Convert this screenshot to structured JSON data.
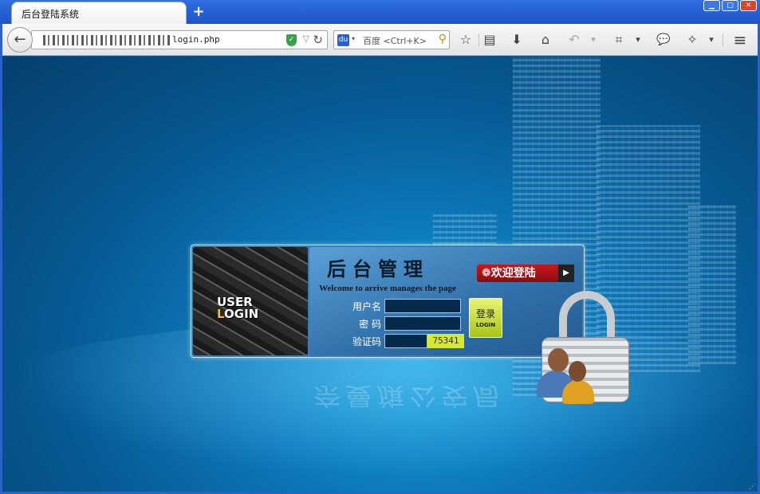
{
  "browser": {
    "tab_title": "后台登陆系统",
    "new_tab_label": "+",
    "window_controls": {
      "minimize": "▁",
      "maximize": "▢",
      "close": "✕"
    },
    "url": "login.php",
    "search_placeholder": "百度 <Ctrl+K>",
    "search_engine_label": "du",
    "icons": [
      "back-icon",
      "shield-icon",
      "dropdown-icon",
      "reload-icon",
      "search-icon",
      "bookmark-star-icon",
      "reading-list-icon",
      "download-icon",
      "home-icon",
      "undo-icon",
      "crop-icon",
      "chat-icon",
      "addon-icon",
      "menu-icon"
    ],
    "toolbar_glyphs": {
      "back": "←",
      "star": "☆",
      "list": "▤",
      "download": "⬇",
      "home": "⌂",
      "undo": "↶",
      "caret": "▾",
      "crop": "⌗",
      "chat": "💬",
      "addon": "✧",
      "menu": "≡",
      "reload": "↻",
      "search_go": "⚲"
    }
  },
  "login": {
    "logo_line1": "USER",
    "logo_line2_first": "L",
    "logo_line2_rest": "OGIN",
    "heading": "后台管理",
    "subheading": "Welcome to arrive manages the page",
    "welcome_badge": "❁欢迎登陆",
    "welcome_arrow": "▶",
    "username_label": "用户名",
    "password_label": "密  码",
    "captcha_label": "验证码",
    "username_value": "",
    "password_value": "",
    "captcha_value": "",
    "captcha_code": "75341",
    "login_button_cn": "登录",
    "login_button_en": "LOGIN"
  },
  "watermark": "奈曼旗公安局",
  "colors": {
    "accent": "#0d7bbc",
    "title_bar": "#2f6fe0",
    "welcome_badge": "#c9181b",
    "login_button": "#a9c516"
  }
}
